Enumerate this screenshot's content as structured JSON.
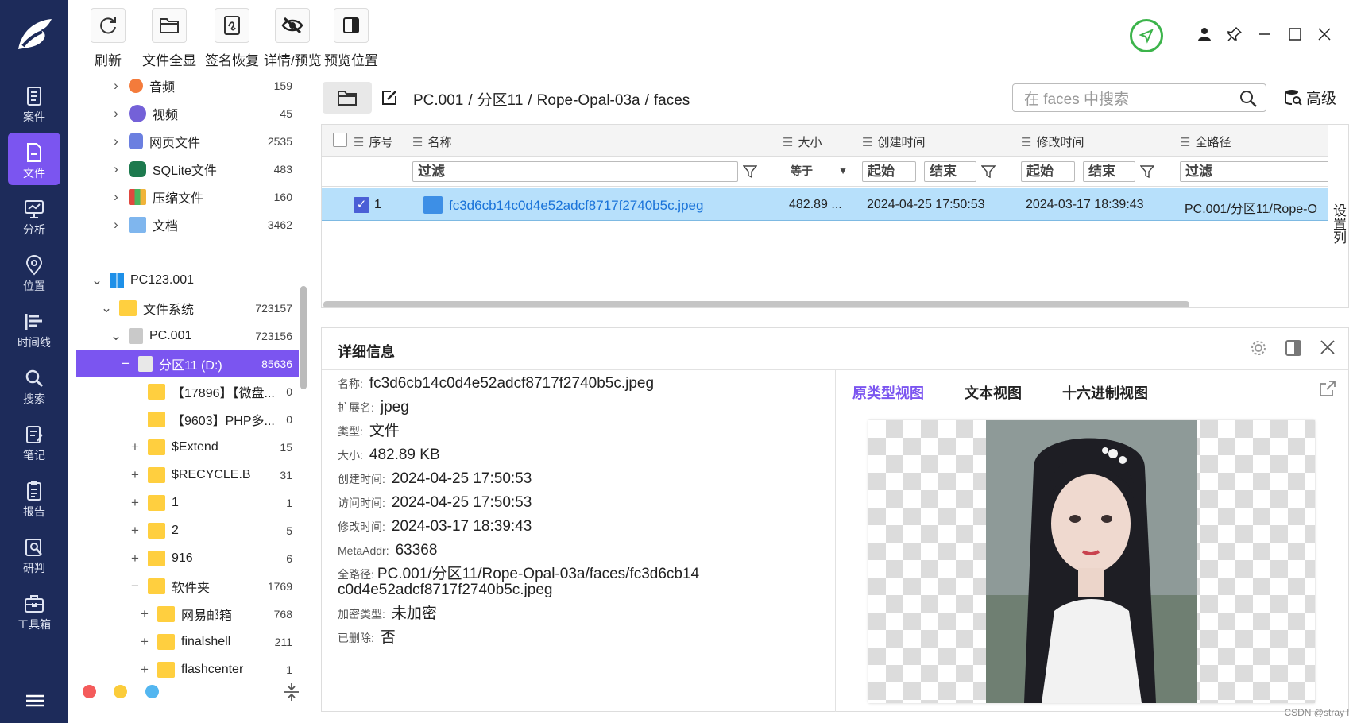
{
  "nav": {
    "items": [
      {
        "label": "案件",
        "icon": "case-icon"
      },
      {
        "label": "文件",
        "icon": "file-icon"
      },
      {
        "label": "分析",
        "icon": "analysis-icon"
      },
      {
        "label": "位置",
        "icon": "location-icon"
      },
      {
        "label": "时间线",
        "icon": "timeline-icon"
      },
      {
        "label": "搜索",
        "icon": "search-icon"
      },
      {
        "label": "笔记",
        "icon": "note-icon"
      },
      {
        "label": "报告",
        "icon": "report-icon"
      },
      {
        "label": "研判",
        "icon": "judge-icon"
      },
      {
        "label": "工具箱",
        "icon": "toolbox-icon"
      }
    ],
    "active": "文件"
  },
  "toolbar": {
    "refresh": "刷新",
    "show_all": "文件全显",
    "sig_restore": "签名恢复",
    "detail_preview": "详情/预览",
    "preview_pos": "预览位置"
  },
  "tree": {
    "rows": [
      {
        "label": "音频",
        "count": "159"
      },
      {
        "label": "视频",
        "count": "45"
      },
      {
        "label": "网页文件",
        "count": "2535"
      },
      {
        "label": "SQLite文件",
        "count": "483"
      },
      {
        "label": "压缩文件",
        "count": "160"
      },
      {
        "label": "文档",
        "count": "3462"
      },
      {
        "label": "PC123.001",
        "count": ""
      },
      {
        "label": "文件系统",
        "count": "723157"
      },
      {
        "label": "PC.001",
        "count": "723156"
      },
      {
        "label": "分区11  (D:)",
        "count": "85636"
      },
      {
        "label": "【17896】【微盘...",
        "count": "0"
      },
      {
        "label": "【9603】PHP多...",
        "count": "0"
      },
      {
        "label": "$Extend",
        "count": "15"
      },
      {
        "label": "$RECYCLE.BIN",
        "count": "31"
      },
      {
        "label": "1",
        "count": "1"
      },
      {
        "label": "2",
        "count": "5"
      },
      {
        "label": "916",
        "count": "6"
      },
      {
        "label": "软件夹",
        "count": "1769"
      },
      {
        "label": "网易邮箱",
        "count": "768"
      },
      {
        "label": "finalshell",
        "count": "211"
      },
      {
        "label": "flashcenter_pp...",
        "count": "1"
      }
    ]
  },
  "path": {
    "crumbs": [
      "PC.001",
      "分区11",
      "Rope-Opal-03a",
      "faces"
    ],
    "search_placeholder": "在 faces 中搜索",
    "advanced": "高级"
  },
  "table": {
    "headers": {
      "index": "序号",
      "name": "名称",
      "size": "大小",
      "created": "创建时间",
      "modified": "修改时间",
      "fullpath": "全路径"
    },
    "filters": {
      "name": "过滤",
      "size_op": "等于",
      "c_start": "起始",
      "c_end": "结束",
      "m_start": "起始",
      "m_end": "结束",
      "path": "过滤"
    },
    "rows": [
      {
        "index": "1",
        "name": "fc3d6cb14c0d4e52adcf8717f2740b5c.jpeg",
        "size": "482.89 ...",
        "created": "2024-04-25 17:50:53",
        "modified": "2024-03-17 18:39:43",
        "fullpath": "PC.001/分区11/Rope-O"
      }
    ],
    "set_columns": "设置列"
  },
  "detail": {
    "title": "详细信息",
    "props": [
      {
        "k": "名称:",
        "v": "fc3d6cb14c0d4e52adcf8717f2740b5c.jpeg"
      },
      {
        "k": "扩展名:",
        "v": "jpeg"
      },
      {
        "k": "类型:",
        "v": "文件"
      },
      {
        "k": "大小:",
        "v": "482.89 KB"
      },
      {
        "k": "创建时间:",
        "v": "2024-04-25 17:50:53"
      },
      {
        "k": "访问时间:",
        "v": "2024-04-25 17:50:53"
      },
      {
        "k": "修改时间:",
        "v": "2024-03-17 18:39:43"
      },
      {
        "k": "MetaAddr:",
        "v": "63368"
      },
      {
        "k": "全路径:",
        "v": "PC.001/分区11/Rope-Opal-03a/faces/fc3d6cb14c0d4e52adcf8717f2740b5c.jpeg"
      },
      {
        "k": "加密类型:",
        "v": "未加密"
      },
      {
        "k": "已删除:",
        "v": "否"
      }
    ],
    "tabs": [
      "原类型视图",
      "文本视图",
      "十六进制视图"
    ],
    "active_tab": "原类型视图"
  },
  "watermark": "CSDN @stray l",
  "colors": {
    "accent": "#7b55f0",
    "nav_bg": "#1d2b5a",
    "row_selected": "#b7e0fb",
    "rocket": "#3cb44b"
  }
}
